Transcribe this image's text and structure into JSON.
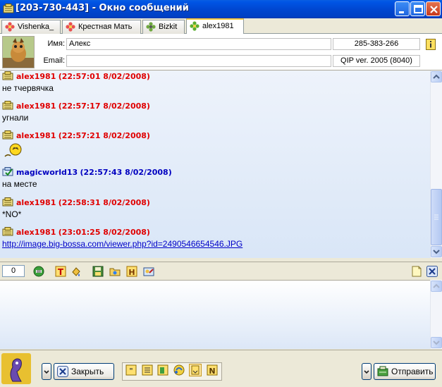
{
  "window": {
    "title": "[203-730-443] - Окно сообщений",
    "accent": "#0055e5"
  },
  "tabs": [
    {
      "label": "Vishenka_",
      "icon": "flower-icon"
    },
    {
      "label": "Крестная Мать",
      "icon": "flower-icon"
    },
    {
      "label": "Bizkit",
      "icon": "flower-icon"
    },
    {
      "label": "alex1981",
      "icon": "flower-green-icon",
      "active": true
    }
  ],
  "contact": {
    "name_label": "Имя:",
    "name_value": "Алекс",
    "email_label": "Email:",
    "email_value": "",
    "uin": "285-383-266",
    "client": "QIP ver. 2005 (8040)"
  },
  "messages": [
    {
      "author": "alex1981",
      "time": "(22:57:01 8/02/2008)",
      "text": "не тчервячка",
      "color": "#e00000"
    },
    {
      "author": "alex1981",
      "time": "(22:57:17 8/02/2008)",
      "text": "угнали",
      "color": "#e00000"
    },
    {
      "author": "alex1981",
      "time": "(22:57:21 8/02/2008)",
      "text": "",
      "smiley": "smiley-icon",
      "color": "#e00000"
    },
    {
      "author": "magicworld13",
      "time": "(22:57:43 8/02/2008)",
      "text": "на месте",
      "color": "#0000c0"
    },
    {
      "author": "alex1981",
      "time": "(22:58:31 8/02/2008)",
      "text": "*NO*",
      "color": "#e00000"
    },
    {
      "author": "alex1981",
      "time": "(23:01:25 8/02/2008)",
      "link": "http://image.big-bossa.com/viewer.php?id=2490546654546.JPG",
      "color": "#e00000"
    }
  ],
  "toolbar": {
    "counter": "0"
  },
  "input": {
    "value": ""
  },
  "bottom": {
    "close_label": "Закрыть",
    "send_label": "Отправить"
  }
}
